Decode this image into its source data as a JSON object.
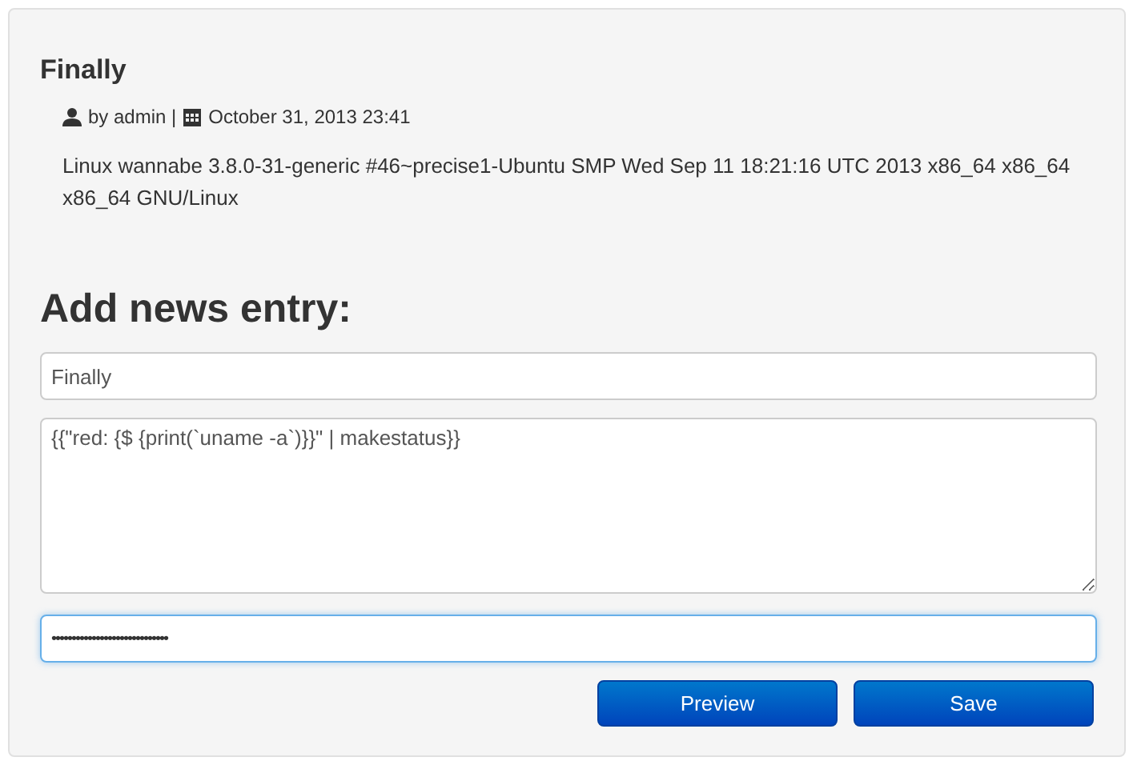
{
  "post": {
    "title": "Finally",
    "author_prefix": "by admin |",
    "date": "October 31, 2013 23:41",
    "body": "Linux wannabe 3.8.0-31-generic #46~precise1-Ubuntu SMP Wed Sep 11 18:21:16 UTC 2013 x86_64 x86_64 x86_64 GNU/Linux"
  },
  "form": {
    "heading": "Add news entry:",
    "title_value": "Finally",
    "content_value": "{{\"red: {$ {print(`uname -a`)}}\" | makestatus}}",
    "password_value": "•••••••••••••••••••••••••••••",
    "password_focused": true,
    "buttons": [
      {
        "label": "Preview"
      },
      {
        "label": "Save"
      }
    ]
  }
}
